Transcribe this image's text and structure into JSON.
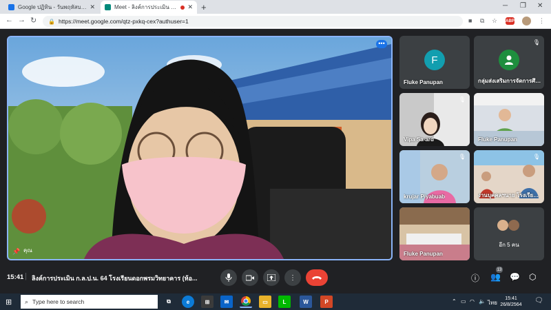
{
  "browser": {
    "tabs": [
      {
        "title": "Google ปฏิทิน - วันพฤหัสบดี, 26 สิงหา",
        "active": false
      },
      {
        "title": "Meet - ลิงค์การประเมิน ก.ล.ป.น.",
        "active": true
      }
    ],
    "new_tab": "+",
    "url": "https://meet.google.com/qtz-pxkq-cex?authuser=1",
    "abp_label": "ABP"
  },
  "meet": {
    "main_speaker": {
      "name": "คุณ"
    },
    "tiles": [
      {
        "name": "Fluke Panupan",
        "initial": "F",
        "avatar_color": "#129eaf",
        "type": "letter"
      },
      {
        "name": "กลุ่มส่งเสริมการจัดการศึก...",
        "type": "person-icon",
        "avatar_color": "#1e8e3e"
      },
      {
        "name": "Vipa Sa-ard",
        "type": "video"
      },
      {
        "name": "Fluke Panupan",
        "type": "video"
      },
      {
        "name": "krujar Piyabuab",
        "type": "video"
      },
      {
        "name": "งานบุคคลฯนาย โรงเรียน...",
        "type": "video"
      },
      {
        "name": "Fluke Panupan",
        "type": "video"
      },
      {
        "name": "อีก 5 คน",
        "type": "more"
      }
    ],
    "bottom": {
      "time": "15:41",
      "separator": "|",
      "meeting_title": "ลิงค์การประเมิน ก.ล.ป.น. 64 โรงเรียนดอกพรมวิทยาคาร (ห้อ...",
      "participants_count": "13"
    }
  },
  "taskbar": {
    "search_placeholder": "Type here to search",
    "tray_lang": "ไทย",
    "clock_time": "15:41",
    "clock_date": "26/8/2564"
  }
}
